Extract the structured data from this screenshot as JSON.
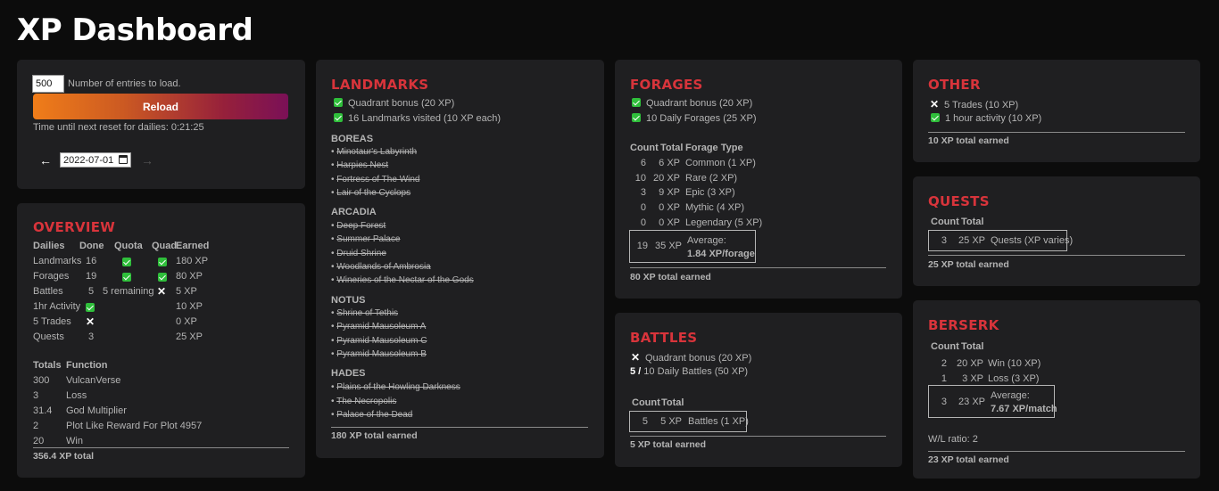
{
  "page": {
    "title": "XP Dashboard"
  },
  "controls": {
    "entries_value": "500",
    "entries_label": "Number of entries to load.",
    "reload_label": "Reload",
    "reset_text": "Time until next reset for dailies: 0:21:25",
    "date_value": "2022-07-01",
    "prev_arrow": "←",
    "next_arrow": "→"
  },
  "overview": {
    "title": "OVERVIEW",
    "headers": {
      "dailies": "Dailies",
      "done": "Done",
      "quota": "Quota",
      "quad": "Quad",
      "earned": "Earned"
    },
    "rows": [
      {
        "name": "Landmarks",
        "done": "16",
        "quota": "check",
        "quota_text": "",
        "quad": "check",
        "earned": "180 XP"
      },
      {
        "name": "Forages",
        "done": "19",
        "quota": "check",
        "quota_text": "",
        "quad": "check",
        "earned": "80 XP"
      },
      {
        "name": "Battles",
        "done": "5",
        "quota": "text",
        "quota_text": "5 remaining",
        "quad": "x",
        "earned": "5 XP"
      },
      {
        "name": "1hr Activity",
        "done": "",
        "done_icon": "check",
        "earned": "10 XP"
      },
      {
        "name": "5 Trades",
        "done": "",
        "done_icon": "x",
        "earned": "0 XP"
      },
      {
        "name": "Quests",
        "done": "3",
        "earned": "25 XP"
      }
    ],
    "totals_headers": {
      "totals": "Totals",
      "function": "Function"
    },
    "totals": [
      {
        "value": "300",
        "function": "VulcanVerse"
      },
      {
        "value": "3",
        "function": "Loss"
      },
      {
        "value": "31.4",
        "function": "God Multiplier"
      },
      {
        "value": "2",
        "function": "Plot Like Reward For Plot 4957"
      },
      {
        "value": "20",
        "function": "Win"
      }
    ],
    "total_xp": "356.4 XP total"
  },
  "landmarks": {
    "title": "LANDMARKS",
    "quadrant_bonus": "Quadrant bonus (20 XP)",
    "visited": "16 Landmarks visited (10 XP each)",
    "regions": [
      {
        "name": "BOREAS",
        "places": [
          "Minotaur's Labyrinth",
          "Harpies Nest",
          "Fortress of The Wind",
          "Lair of the Cyclops"
        ]
      },
      {
        "name": "ARCADIA",
        "places": [
          "Deep Forest",
          "Summer Palace",
          "Druid Shrine",
          "Woodlands of Ambrosia",
          "Wineries of the Nectar of the Gods"
        ]
      },
      {
        "name": "NOTUS",
        "places": [
          "Shrine of Tethis",
          "Pyramid Mausoleum A",
          "Pyramid Mausoleum C",
          "Pyramid Mausoleum B"
        ]
      },
      {
        "name": "HADES",
        "places": [
          "Plains of the Howling Darkness",
          "The Necropolis",
          "Palace of the Dead"
        ]
      }
    ],
    "bullet": "•",
    "total": "180 XP total earned"
  },
  "forages": {
    "title": "FORAGES",
    "quadrant_bonus": "Quadrant bonus (20 XP)",
    "daily": "10 Daily Forages (25 XP)",
    "headers": {
      "count": "Count",
      "total": "Total",
      "type": "Forage Type"
    },
    "rows": [
      {
        "count": "6",
        "total": "6 XP",
        "type": "Common (1 XP)"
      },
      {
        "count": "10",
        "total": "20 XP",
        "type": "Rare (2 XP)"
      },
      {
        "count": "3",
        "total": "9 XP",
        "type": "Epic (3 XP)"
      },
      {
        "count": "0",
        "total": "0 XP",
        "type": "Mythic (4 XP)"
      },
      {
        "count": "0",
        "total": "0 XP",
        "type": "Legendary (5 XP)"
      }
    ],
    "summary": {
      "count": "19",
      "total": "35 XP",
      "avg_label": "Average:",
      "avg_value": "1.84 XP/forage"
    },
    "total": "80 XP total earned"
  },
  "battles": {
    "title": "BATTLES",
    "quadrant_bonus": "Quadrant bonus (20 XP)",
    "progress_count": "5 /",
    "daily": "10 Daily Battles (50 XP)",
    "headers": {
      "count": "Count",
      "total": "Total"
    },
    "row": {
      "count": "5",
      "total": "5 XP",
      "type": "Battles (1 XP)"
    },
    "total": "5 XP total earned"
  },
  "other": {
    "title": "OTHER",
    "trades": "5 Trades (10 XP)",
    "activity": "1 hour activity (10 XP)",
    "total": "10 XP total earned"
  },
  "quests": {
    "title": "QUESTS",
    "headers": {
      "count": "Count",
      "total": "Total"
    },
    "row": {
      "count": "3",
      "total": "25 XP",
      "type": "Quests (XP varies)"
    },
    "total": "25 XP total earned"
  },
  "berserk": {
    "title": "BERSERK",
    "headers": {
      "count": "Count",
      "total": "Total"
    },
    "rows": [
      {
        "count": "2",
        "total": "20 XP",
        "type": "Win (10 XP)"
      },
      {
        "count": "1",
        "total": "3 XP",
        "type": "Loss (3 XP)"
      }
    ],
    "summary": {
      "count": "3",
      "total": "23 XP",
      "avg_label": "Average:",
      "avg_value": "7.67 XP/match"
    },
    "wl_ratio": "W/L ratio: 2",
    "total": "23 XP total earned"
  }
}
